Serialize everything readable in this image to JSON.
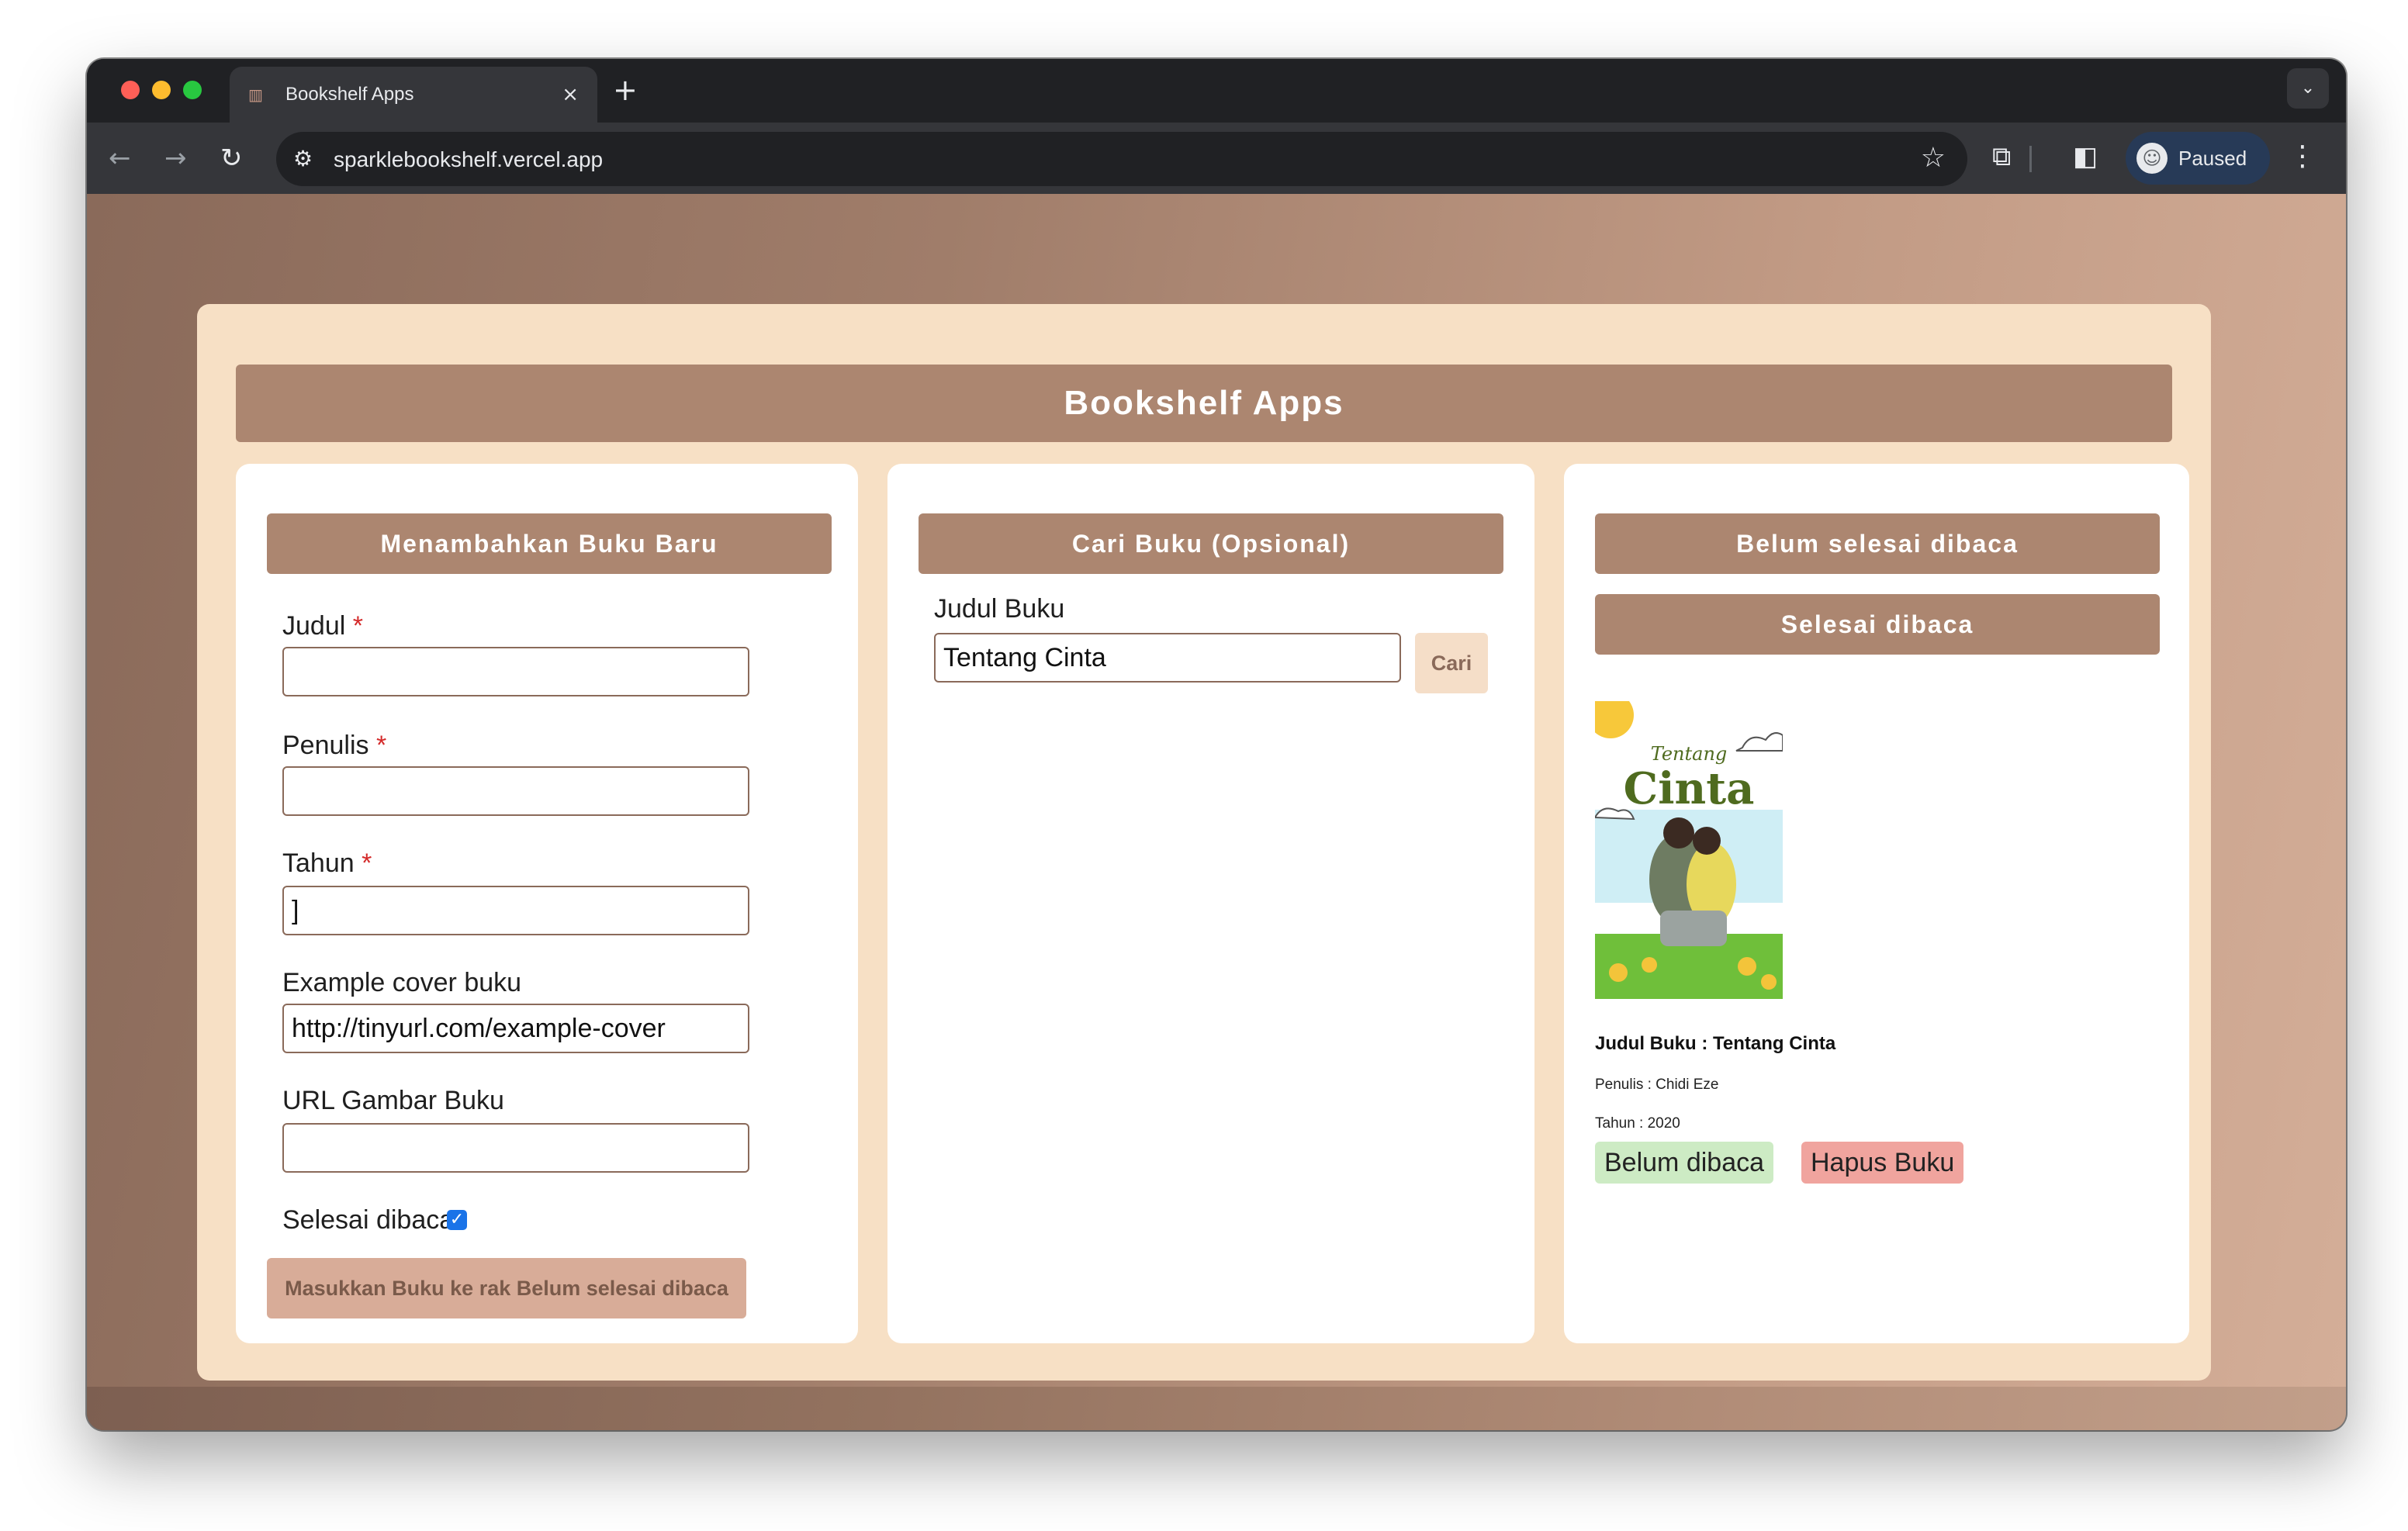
{
  "browser": {
    "tab_title": "Bookshelf Apps",
    "tab_favicon": "bookshelf-favicon",
    "close_glyph": "×",
    "newtab_glyph": "+",
    "tab_dropdown_glyph": "⌄",
    "url": "sparklebookshelf.vercel.app",
    "profile_label": "Paused",
    "icons": [
      "back-icon",
      "forward-icon",
      "reload-icon",
      "site-settings-icon",
      "star-icon",
      "extensions-icon",
      "sidepanel-icon",
      "menu-icon"
    ],
    "accent": "#273a57"
  },
  "app": {
    "title": "Bookshelf Apps",
    "colors": {
      "primary": "#ac8670",
      "page": "#f7e0c5",
      "green_pill": "#cdebc4",
      "red_pill": "#f0a49e"
    }
  },
  "add_form": {
    "heading": "Menambahkan Buku Baru",
    "required_mark": "*",
    "fields": [
      {
        "label": "Judul",
        "required": true,
        "value": "",
        "placeholder": ""
      },
      {
        "label": "Penulis",
        "required": true,
        "value": "",
        "placeholder": ""
      },
      {
        "label": "Tahun",
        "required": true,
        "value": "]",
        "placeholder": ""
      },
      {
        "label": "Example cover buku",
        "required": false,
        "value": "http://tinyurl.com/example-cover",
        "placeholder": ""
      },
      {
        "label": "URL Gambar Buku",
        "required": false,
        "value": "",
        "placeholder": ""
      }
    ],
    "checkbox_label": "Selesai dibaca",
    "checkbox_checked": true,
    "submit_label": "Masukkan Buku ke rak Belum selesai dibaca"
  },
  "search": {
    "heading": "Cari Buku (Opsional)",
    "label": "Judul Buku",
    "value": "Tentang Cinta",
    "button": "Cari"
  },
  "shelves": {
    "unfinished_label": "Belum selesai dibaca",
    "finished_label": "Selesai dibaca",
    "book": {
      "cover_title_top": "Tentang",
      "cover_title_main": "Cinta",
      "title_line": "Judul Buku : Tentang Cinta",
      "author_line": "Penulis : Chidi Eze",
      "year_line": "Tahun : 2020",
      "action_toggle": "Belum dibaca",
      "action_delete": "Hapus Buku"
    }
  }
}
